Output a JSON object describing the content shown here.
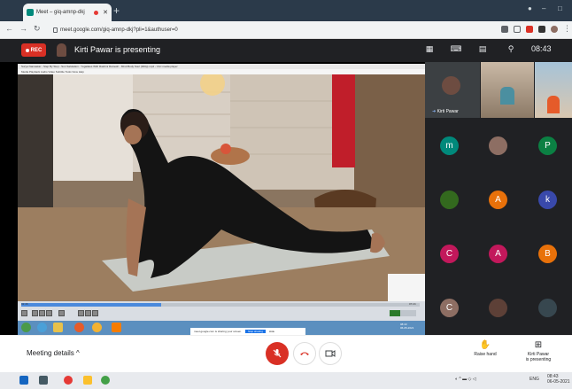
{
  "browser": {
    "tab_title": "Meet – giq-amnp-dkj",
    "new_tab": "+",
    "url": "meet.google.com/giq-amnp-dkj?pli=1&authuser=0",
    "window_min": "–",
    "window_restore": "□"
  },
  "meet_top": {
    "rec_label": "REC",
    "presenting_text": "Kirti Pawar is presenting",
    "clock": "08:43"
  },
  "shared_screen": {
    "vlc_title": "Surya Namaskar - Step By Step - Sun Salutation - Yogalates With Rashmi Ramesh - Mind Body Soul (360p).mp4 - VLC media player",
    "vlc_menu": "Media   Playback   Audio   Video   Subtitle   Tools   View   Help",
    "time_elapsed": "02:46",
    "time_total": "07:24",
    "progress_fraction": 0.35,
    "volume_percent": 40,
    "share_notice": "meet.google.com is sharing your screen.",
    "stop_sharing": "Stop sharing",
    "hide": "Hide",
    "taskbar_clock": "08:43",
    "taskbar_date": "06-05-2021"
  },
  "participants": [
    {
      "initial": "m",
      "color": "#00897b"
    },
    {
      "initial": "",
      "color": "#8d6e63"
    },
    {
      "initial": "P",
      "color": "#0b8043"
    },
    {
      "initial": "",
      "color": "#33691e"
    },
    {
      "initial": "A",
      "color": "#e8710a"
    },
    {
      "initial": "k",
      "color": "#3949ab"
    },
    {
      "initial": "C",
      "color": "#c2185b"
    },
    {
      "initial": "A",
      "color": "#c2185b"
    },
    {
      "initial": "B",
      "color": "#e8710a"
    },
    {
      "initial": "C",
      "color": "#8d6e63"
    },
    {
      "initial": "",
      "color": "#5d4037"
    },
    {
      "initial": "",
      "color": "#37474f"
    }
  ],
  "presenter_tile": {
    "name": "Kirti Pawar"
  },
  "bottom": {
    "meeting_details": "Meeting details",
    "raise_hand": "Raise hand",
    "presenting_line1": "Kirti Pawar",
    "presenting_line2": "is presenting"
  },
  "windows": {
    "lang": "ENG",
    "time": "08:43",
    "date": "06-05-2021"
  },
  "colors": {
    "accent_red": "#d93025",
    "meet_dark": "#202124"
  }
}
